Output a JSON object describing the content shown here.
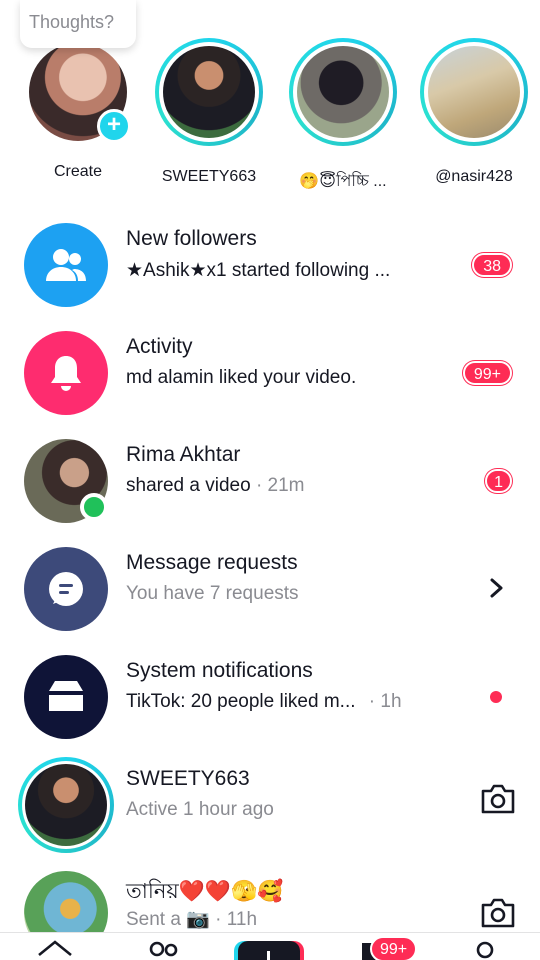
{
  "thoughts": {
    "placeholder": "Thoughts?"
  },
  "stories": [
    {
      "name": "Create",
      "has_plus": true
    },
    {
      "name": "SWEETY663"
    },
    {
      "name": "🤭😇পিচ্চি ..."
    },
    {
      "name": "@nasir428"
    }
  ],
  "list": [
    {
      "title": "New followers",
      "subtitle": "★Ashik★x1 started following ...",
      "badge": "38",
      "icon": "people-icon",
      "color": "#1da1f2"
    },
    {
      "title": "Activity",
      "subtitle": "md alamin liked your video.",
      "badge": "99+",
      "icon": "bell-icon",
      "color": "#fe2c6f"
    },
    {
      "title": "Rima Akhtar",
      "subtitle": "shared a video",
      "time": "· 21m",
      "badge": "1",
      "online": true
    },
    {
      "title": "Message requests",
      "subtitle": "You have 7 requests",
      "icon": "message-icon",
      "color": "#3d4a7a"
    },
    {
      "title": "System notifications",
      "subtitle": "TikTok: 20 people liked m...",
      "time": "· 1h",
      "icon": "inbox-icon",
      "color": "#0f1437"
    },
    {
      "title": "SWEETY663",
      "subtitle": "Active 1 hour ago"
    },
    {
      "title": "তানিয়❤️❤️🫣🥰",
      "subtitle": "Sent a 📷 · 11h"
    }
  ],
  "nav": {
    "inbox_badge": "99+"
  },
  "colors": {
    "accent": "#fe2c55",
    "story_ring": "#20d5ec",
    "online": "#20c15a"
  }
}
